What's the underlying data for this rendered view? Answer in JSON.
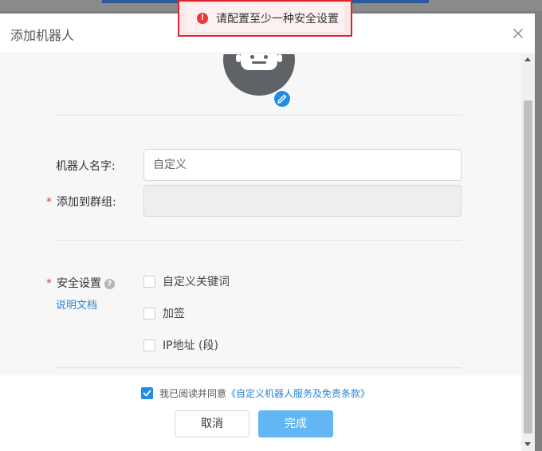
{
  "dialog": {
    "title": "添加机器人"
  },
  "form": {
    "name_label": "机器人名字:",
    "name_value": "自定义",
    "group_label": "添加到群组:",
    "group_value": "",
    "required_mark": "*",
    "security_label": "安全设置",
    "help_glyph": "?",
    "doc_link": "说明文档",
    "security_options": [
      {
        "label": "自定义关键词",
        "checked": false
      },
      {
        "label": "加签",
        "checked": false
      },
      {
        "label": "IP地址 (段)",
        "checked": false
      }
    ]
  },
  "footer": {
    "agree_prefix": "我已阅读并同意",
    "agree_link": "《自定义机器人服务及免责条款》",
    "agree_checked": true,
    "cancel_label": "取消",
    "ok_label": "完成"
  },
  "toast": {
    "icon_glyph": "!",
    "message": "请配置至少一种安全设置"
  },
  "colors": {
    "accent": "#1f8ce8",
    "link": "#2a86d6",
    "ok_button": "#63b6f4",
    "error": "#e9373a",
    "required": "#e03a3a"
  }
}
